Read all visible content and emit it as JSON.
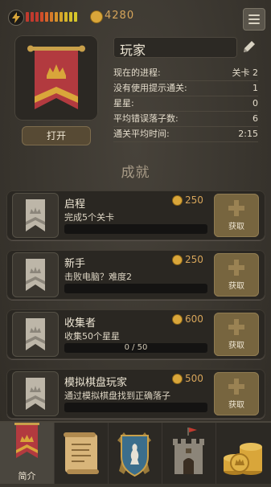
{
  "header": {
    "coins": "4280",
    "energy_bar_colors": [
      "#c23a2e",
      "#c23a2e",
      "#c23a2e",
      "#d04d2a",
      "#d6642a",
      "#d67b2a",
      "#d6922a",
      "#d6a52a",
      "#d6b52a",
      "#d6c02a",
      "#d6c72a"
    ],
    "icons": {
      "energy": "lightning-icon",
      "coin": "coin-icon",
      "menu": "menu-icon"
    }
  },
  "profile": {
    "name": "玩家",
    "open_button": "打开",
    "stats": [
      {
        "label": "现在的进程:",
        "value": "关卡 2"
      },
      {
        "label": "没有使用提示通关:",
        "value": "1"
      },
      {
        "label": "星星:",
        "value": "0"
      },
      {
        "label": "平均错误落子数:",
        "value": "6"
      },
      {
        "label": "通关平均时间:",
        "value": "2:15"
      }
    ]
  },
  "section_title": "成就",
  "achievements": [
    {
      "title": "启程",
      "reward": "250",
      "desc": "完成5个关卡",
      "progress_text": "",
      "claim": "获取"
    },
    {
      "title": "新手",
      "reward": "250",
      "desc": "击败电脑？难度2",
      "progress_text": "",
      "claim": "获取"
    },
    {
      "title": "收集者",
      "reward": "600",
      "desc": "收集50个星星",
      "progress_text": "0 / 50",
      "claim": "获取"
    },
    {
      "title": "模拟棋盘玩家",
      "reward": "500",
      "desc": "通过模拟棋盘找到正确落子",
      "progress_text": "",
      "claim": "获取"
    }
  ],
  "nav": {
    "tabs": [
      {
        "label": "简介",
        "icon": "banner-icon"
      },
      {
        "label": "",
        "icon": "scroll-icon"
      },
      {
        "label": "",
        "icon": "shield-icon"
      },
      {
        "label": "",
        "icon": "castle-icon"
      },
      {
        "label": "",
        "icon": "coins-icon"
      }
    ]
  },
  "colors": {
    "accent": "#d7a55a",
    "banner_red": "#b23a3f",
    "claim_btn": "#77653f"
  }
}
